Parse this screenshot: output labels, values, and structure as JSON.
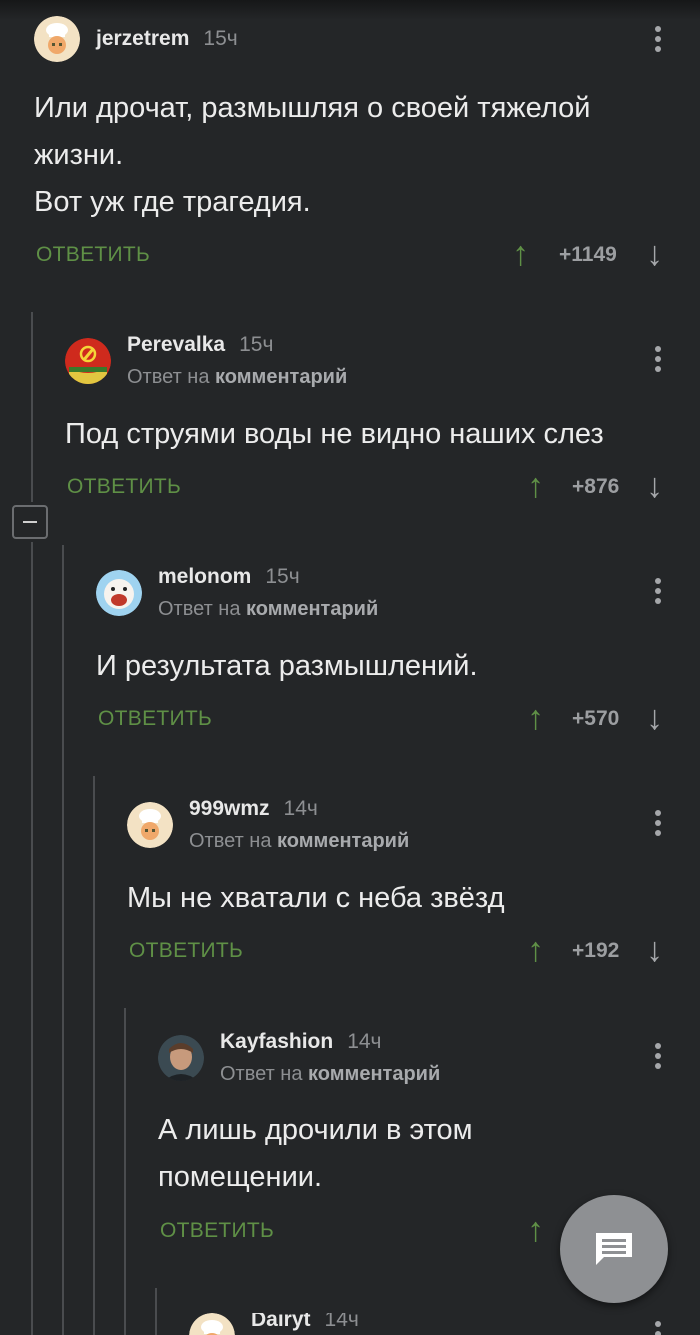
{
  "comments": [
    {
      "author": "jerzetrem",
      "time": "15ч",
      "text": "Или дрочат, размышляя о своей тяжелой\nжизни.\nВот уж где трагедия.",
      "reply_label": "ОТВЕТИТЬ",
      "score": "+1149",
      "avatar": "chef-avatar"
    },
    {
      "author": "Perevalka",
      "time": "15ч",
      "reply_to_prefix": "Ответ на",
      "reply_to_link": "комментарий",
      "text": "Под струями воды не видно наших слез",
      "reply_label": "ОТВЕТИТЬ",
      "score": "+876",
      "avatar": "soviet-emblem-avatar"
    },
    {
      "author": "melonom",
      "time": "15ч",
      "reply_to_prefix": "Ответ на",
      "reply_to_link": "комментарий",
      "text": "И результата размышлений.",
      "reply_label": "ОТВЕТИТЬ",
      "score": "+570",
      "avatar": "cartoon-face-avatar"
    },
    {
      "author": "999wmz",
      "time": "14ч",
      "reply_to_prefix": "Ответ на",
      "reply_to_link": "комментарий",
      "text": "Мы не хватали с неба звёзд",
      "reply_label": "ОТВЕТИТЬ",
      "score": "+192",
      "avatar": "chef-avatar"
    },
    {
      "author": "Kayfashion",
      "time": "14ч",
      "reply_to_prefix": "Ответ на",
      "reply_to_link": "комментарий",
      "text": "А лишь дрочили в этом\nпомещении.",
      "reply_label": "ОТВЕТИТЬ",
      "avatar": "man-portrait-avatar"
    },
    {
      "author": "Dairyt",
      "time": "14ч",
      "avatar": "chef-avatar"
    }
  ],
  "colors": {
    "background": "#242628",
    "accent_green": "#5f9046",
    "muted_text": "#8d8f92"
  },
  "icons": {
    "upvote": "arrow-up-icon",
    "downvote": "arrow-down-icon",
    "menu": "more-vertical-icon",
    "collapse": "collapse-minus-icon",
    "fab": "comment-icon"
  }
}
